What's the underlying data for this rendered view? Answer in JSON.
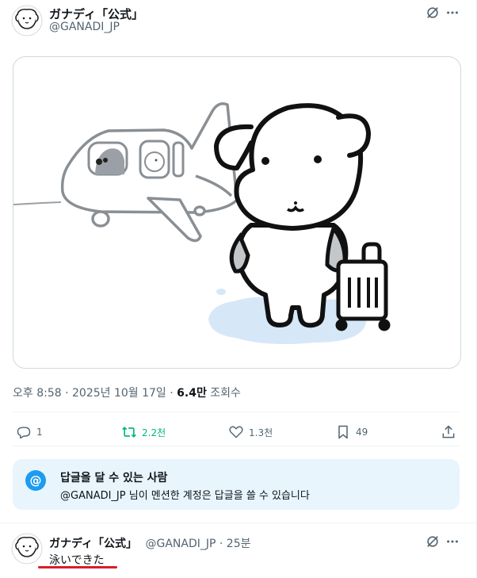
{
  "tweet": {
    "display_name": "ガナディ「公式」",
    "handle": "@GANADI_JP",
    "timestamp": "오후 8:58 · 2025년 10월 17일 · ",
    "views_count": "6.4만",
    "views_label": " 조회수"
  },
  "actions": {
    "replies": "1",
    "retweets": "2.2천",
    "likes": "1.3천",
    "bookmarks": "49"
  },
  "reply_restriction": {
    "icon_text": "@",
    "title": "답글을 달 수 있는 사람",
    "subtitle": "@GANADI_JP 님이 멘션한 계정은 답글을 쓸 수 있습니다"
  },
  "reply": {
    "display_name": "ガナディ「公式」",
    "handle_time": "@GANADI_JP · 25분",
    "text": "泳いできた"
  },
  "icons": {
    "grok": "grok-icon",
    "more": "more-icon",
    "reply": "reply-icon",
    "retweet": "retweet-icon",
    "like": "like-icon",
    "bookmark": "bookmark-icon",
    "share": "share-icon"
  },
  "colors": {
    "accent": "#1d9bf0",
    "retweet_active": "#00ba7c",
    "underline": "#d81e2a",
    "restriction_bg": "#e8f5fd"
  }
}
